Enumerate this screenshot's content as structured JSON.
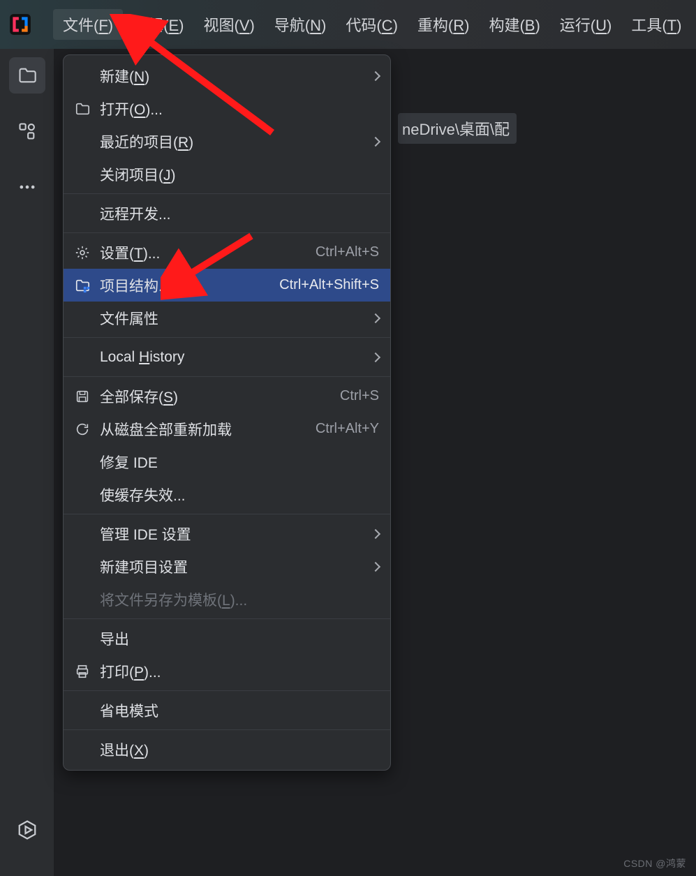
{
  "menubar": {
    "items": [
      {
        "label": "文件",
        "mn": "F",
        "active": true
      },
      {
        "label": "编辑",
        "mn": "E"
      },
      {
        "label": "视图",
        "mn": "V"
      },
      {
        "label": "导航",
        "mn": "N"
      },
      {
        "label": "代码",
        "mn": "C"
      },
      {
        "label": "重构",
        "mn": "R"
      },
      {
        "label": "构建",
        "mn": "B"
      },
      {
        "label": "运行",
        "mn": "U"
      },
      {
        "label": "工具",
        "mn": "T"
      }
    ]
  },
  "toolstrip": {
    "items": [
      {
        "name": "project-tool",
        "icon": "folder",
        "selected": true
      },
      {
        "name": "structure-tool",
        "icon": "structure"
      },
      {
        "name": "more-tool",
        "icon": "dots"
      }
    ],
    "bottom": {
      "name": "services-tool",
      "icon": "play-hex"
    }
  },
  "editor": {
    "path_fragment": "neDrive\\桌面\\配"
  },
  "dropdown": {
    "groups": [
      [
        {
          "label": "新建",
          "mn": "N",
          "sub": true
        },
        {
          "icon": "folder",
          "label": "打开",
          "mn": "O",
          "suffix": "..."
        },
        {
          "label": "最近的项目",
          "mn": "R",
          "sub": true
        },
        {
          "label": "关闭项目",
          "mn": "J"
        }
      ],
      [
        {
          "label": "远程开发...",
          "plain": true
        }
      ],
      [
        {
          "icon": "gear",
          "label": "设置",
          "mn": "T",
          "suffix": "...",
          "shortcut": "Ctrl+Alt+S"
        },
        {
          "icon": "proj-struct",
          "label": "项目结构...",
          "plain": true,
          "shortcut": "Ctrl+Alt+Shift+S",
          "highlight": true
        },
        {
          "label": "文件属性",
          "plain": true,
          "sub": true
        }
      ],
      [
        {
          "label_html": "Local <u>H</u>istory",
          "sub": true
        }
      ],
      [
        {
          "icon": "save",
          "label": "全部保存",
          "mn": "S",
          "shortcut": "Ctrl+S"
        },
        {
          "icon": "reload",
          "label": "从磁盘全部重新加载",
          "plain": true,
          "shortcut": "Ctrl+Alt+Y"
        },
        {
          "label": "修复 IDE",
          "plain": true
        },
        {
          "label": "使缓存失效...",
          "plain": true
        }
      ],
      [
        {
          "label": "管理 IDE 设置",
          "plain": true,
          "sub": true
        },
        {
          "label": "新建项目设置",
          "plain": true,
          "sub": true
        },
        {
          "label": "将文件另存为模板",
          "mn": "L",
          "suffix": "...",
          "disabled": true
        }
      ],
      [
        {
          "label": "导出",
          "plain": true
        },
        {
          "icon": "print",
          "label": "打印",
          "mn": "P",
          "suffix": "..."
        }
      ],
      [
        {
          "label": "省电模式",
          "plain": true
        }
      ],
      [
        {
          "label": "退出",
          "mn": "X"
        }
      ]
    ]
  },
  "watermark": "CSDN @鸿蒙"
}
